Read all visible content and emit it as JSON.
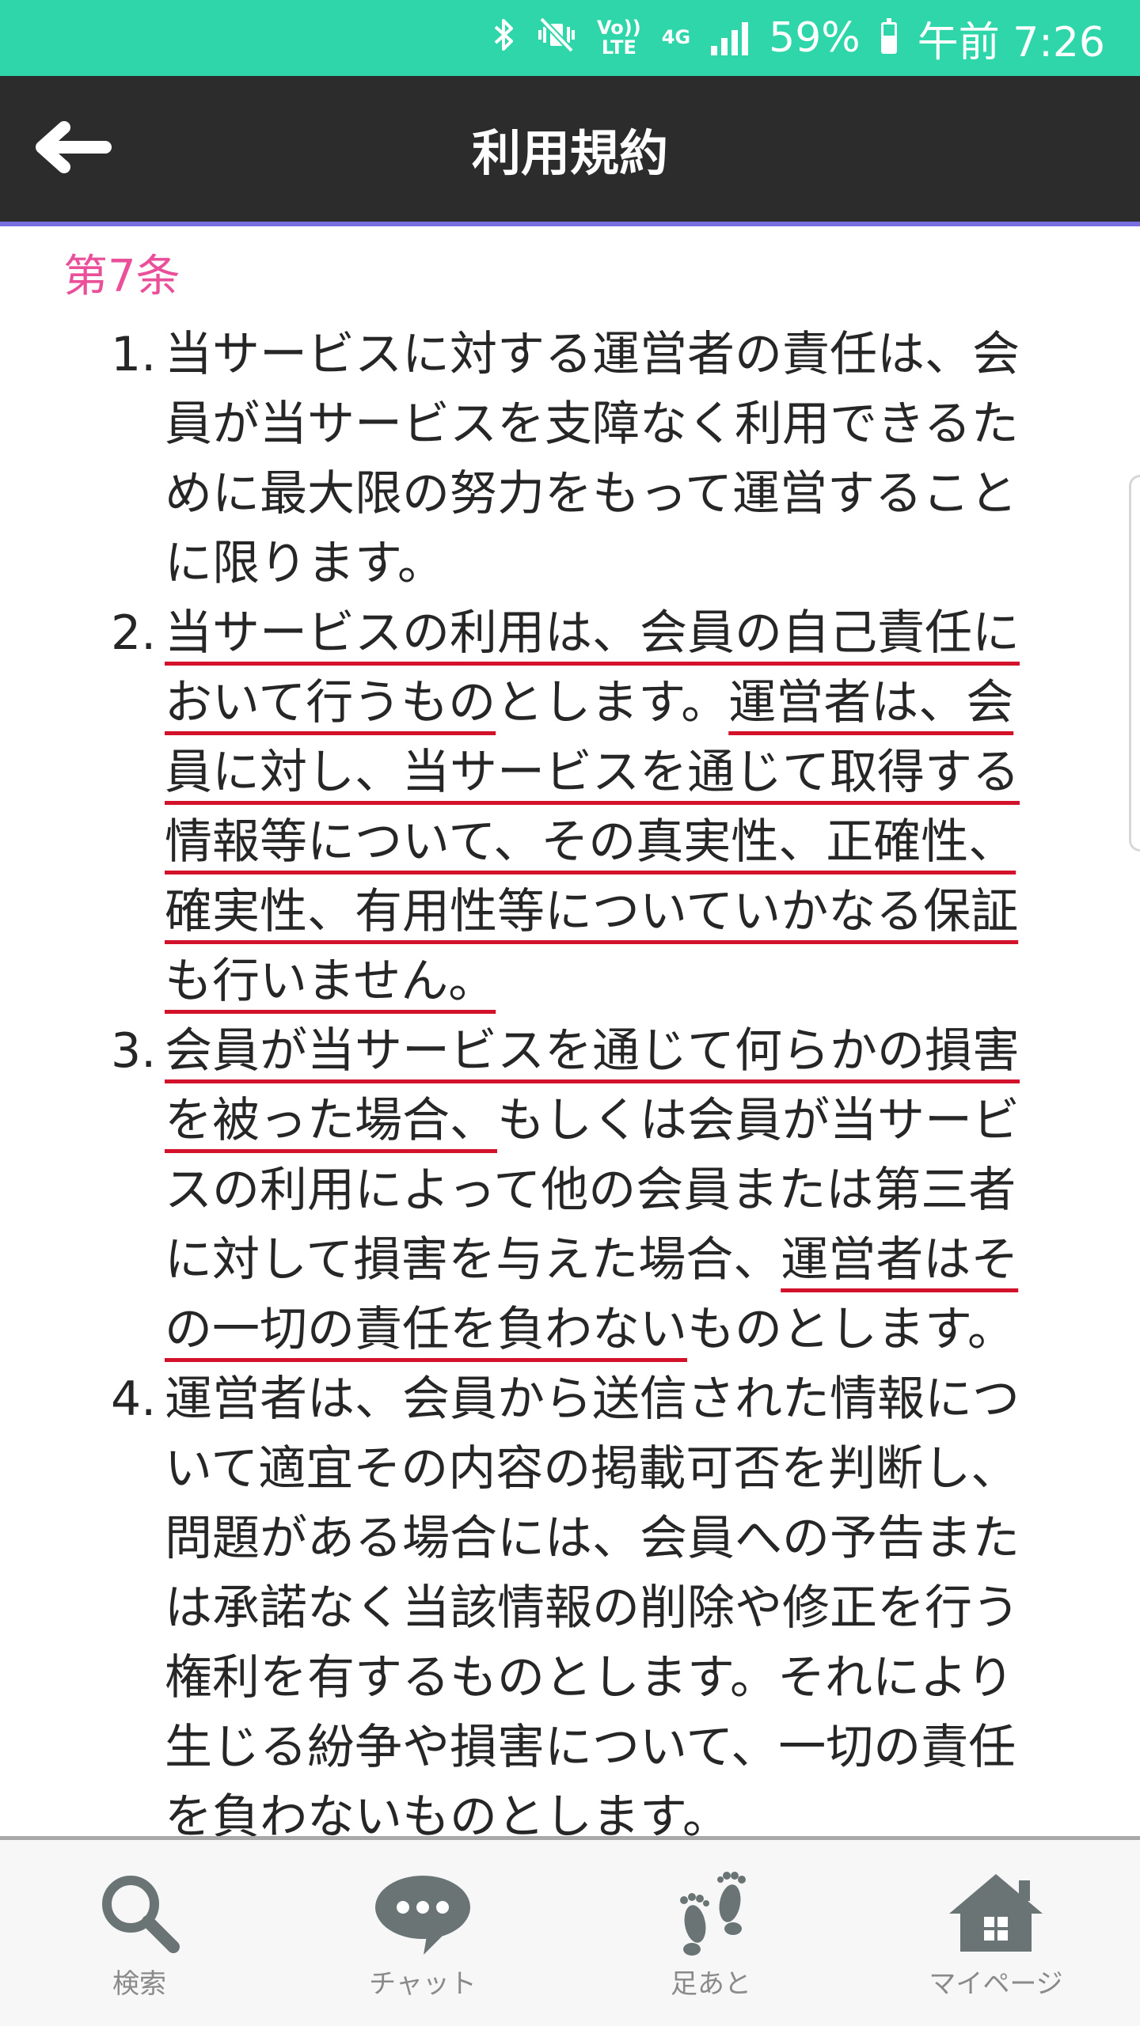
{
  "status_bar": {
    "network_lte": "Vo))\nLTE",
    "network_4g": "4G",
    "battery": "59%",
    "battery_level": 0.59,
    "time": "午前 7:26"
  },
  "app_bar": {
    "title": "利用規約"
  },
  "article": {
    "heading": "第7条",
    "items": [
      {
        "number": "1.",
        "segments": [
          {
            "text": "当サービスに対する運営者の責任は、会員が当サービスを支障なく利用できるために最大限の努力をもって運営することに限ります。",
            "underlined": false
          }
        ]
      },
      {
        "number": "2.",
        "segments": [
          {
            "text": "当サービスの利用は、会員の自己責任において行うもの",
            "underlined": true
          },
          {
            "text": "とします。",
            "underlined": false
          },
          {
            "text": "運営者は、会員に対し、当サービスを通じて取得する情報等について、その真実性、正確性、確実性、有用性等についていかなる保証も行いません。",
            "underlined": true
          }
        ]
      },
      {
        "number": "3.",
        "segments": [
          {
            "text": "会員が当サービスを通じて何らかの損害を被った場合、",
            "underlined": true
          },
          {
            "text": "もしくは会員が当サービスの利用によって他の会員または第三者に対して損害を与えた場合、",
            "underlined": false
          },
          {
            "text": "運営者はその一切の責任を負わない",
            "underlined": true
          },
          {
            "text": "ものとします。",
            "underlined": false
          }
        ]
      },
      {
        "number": "4.",
        "segments": [
          {
            "text": "運営者は、会員から送信された情報について適宜その内容の掲載可否を判断し、問題がある場合には、会員への予告または承諾なく当該情報の削除や修正を行う権利を有するものとします。それにより生じる紛争や損害について、一切の責任を負わないものとします。",
            "underlined": false
          }
        ]
      }
    ]
  },
  "bottom_nav": {
    "items": [
      {
        "label": "検索",
        "icon": "search-icon"
      },
      {
        "label": "チャット",
        "icon": "chat-icon"
      },
      {
        "label": "足あと",
        "icon": "footprints-icon"
      },
      {
        "label": "マイページ",
        "icon": "home-icon"
      }
    ]
  },
  "colors": {
    "status_bar": "#2fd6a9",
    "app_bar": "#2c2c2c",
    "heading": "#ea4f9a",
    "underline": "#d4112b",
    "nav_icon": "#6b7474"
  }
}
